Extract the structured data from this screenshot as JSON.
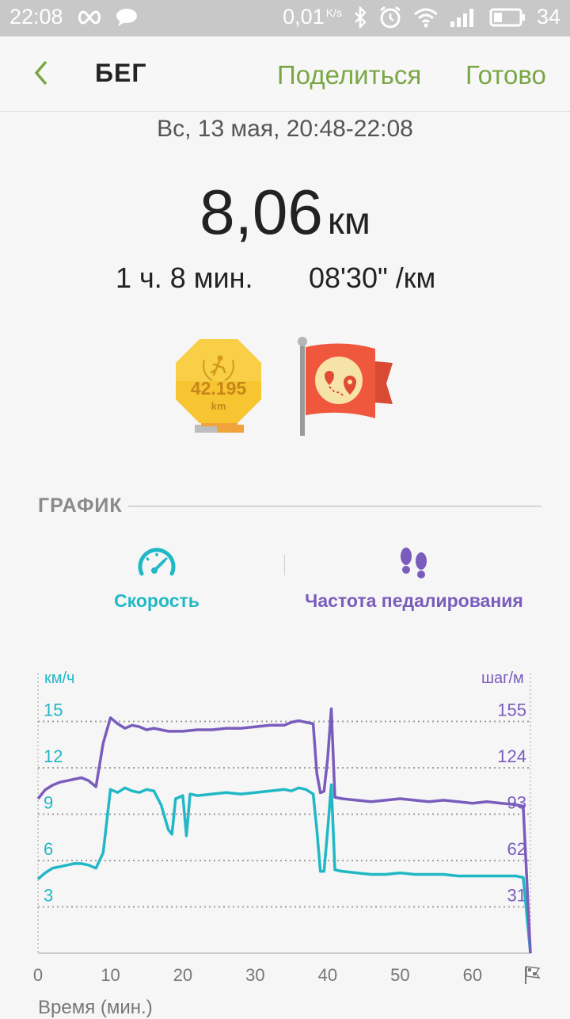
{
  "status_bar": {
    "time": "22:08",
    "net_speed": "0,01",
    "net_unit": "K/s",
    "battery": "34"
  },
  "app_bar": {
    "title": "БЕГ",
    "share_label": "Поделиться",
    "done_label": "Готово"
  },
  "workout": {
    "date": "Вс, 13 мая, 20:48-22:08",
    "distance_value": "8,06",
    "distance_unit": "км",
    "duration": "1 ч. 8 мин.",
    "pace": "08'30\" /км"
  },
  "badges": {
    "marathon_text": "42.195",
    "marathon_unit": "km"
  },
  "graph": {
    "section_title": "ГРАФИК",
    "tabs": [
      {
        "label": "Скорость",
        "icon": "speedometer-icon",
        "color": "#21b8c6"
      },
      {
        "label": "Частота педалирования",
        "icon": "footprints-icon",
        "color": "#7a5cbc"
      }
    ]
  },
  "chart_data": {
    "type": "line",
    "left_axis_unit": "км/ч",
    "right_axis_unit": "шаг/м",
    "left_ticks": [
      "15",
      "12",
      "9",
      "6",
      "3"
    ],
    "right_ticks": [
      "155",
      "124",
      "93",
      "62",
      "31"
    ],
    "x_ticks": [
      "0",
      "10",
      "20",
      "30",
      "40",
      "50",
      "60"
    ],
    "xlabel": "Время (мин.)",
    "xlim": [
      0,
      68
    ],
    "series": [
      {
        "color": "#21b8c6",
        "axis": "left",
        "x": [
          0,
          1,
          2,
          3,
          4,
          5,
          6,
          7,
          8,
          9,
          10,
          11,
          12,
          13,
          14,
          15,
          16,
          17,
          18,
          18.5,
          19,
          20,
          20.5,
          21,
          22,
          24,
          26,
          28,
          30,
          32,
          34,
          35,
          36,
          37,
          38,
          38.5,
          39,
          39.5,
          40,
          40.5,
          41,
          42,
          44,
          46,
          48,
          50,
          52,
          54,
          56,
          58,
          60,
          62,
          64,
          66,
          67,
          68
        ],
        "y": [
          4.8,
          5.2,
          5.5,
          5.6,
          5.7,
          5.8,
          5.8,
          5.7,
          5.5,
          6.5,
          10.6,
          10.4,
          10.7,
          10.5,
          10.4,
          10.6,
          10.5,
          9.6,
          8.0,
          7.7,
          10.0,
          10.2,
          7.6,
          10.3,
          10.2,
          10.3,
          10.4,
          10.3,
          10.4,
          10.5,
          10.6,
          10.5,
          10.7,
          10.6,
          10.3,
          8.0,
          5.3,
          5.3,
          8.0,
          10.9,
          5.4,
          5.3,
          5.2,
          5.1,
          5.1,
          5.2,
          5.1,
          5.1,
          5.1,
          5.0,
          5.0,
          5.0,
          5.0,
          5.0,
          4.9,
          0.0
        ]
      },
      {
        "color": "#7a5cbc",
        "axis": "right",
        "x": [
          0,
          1,
          2,
          3,
          4,
          5,
          6,
          7,
          8,
          9,
          10,
          11,
          12,
          13,
          14,
          15,
          16,
          17,
          18,
          20,
          22,
          24,
          26,
          28,
          30,
          32,
          34,
          35,
          36,
          37,
          38,
          38.5,
          39,
          39.5,
          40,
          40.5,
          41,
          42,
          44,
          46,
          48,
          50,
          52,
          54,
          56,
          58,
          60,
          62,
          64,
          66,
          67,
          68
        ],
        "y": [
          103,
          109,
          112,
          114,
          115,
          116,
          117,
          115,
          111,
          140,
          157,
          153,
          150,
          152,
          151,
          149,
          150,
          149,
          148,
          148,
          149,
          149,
          150,
          150,
          151,
          152,
          152,
          154,
          155,
          154,
          153,
          120,
          107,
          108,
          130,
          163,
          104,
          103,
          102,
          101,
          102,
          103,
          102,
          101,
          102,
          101,
          100,
          101,
          100,
          99,
          98,
          0
        ]
      }
    ]
  }
}
